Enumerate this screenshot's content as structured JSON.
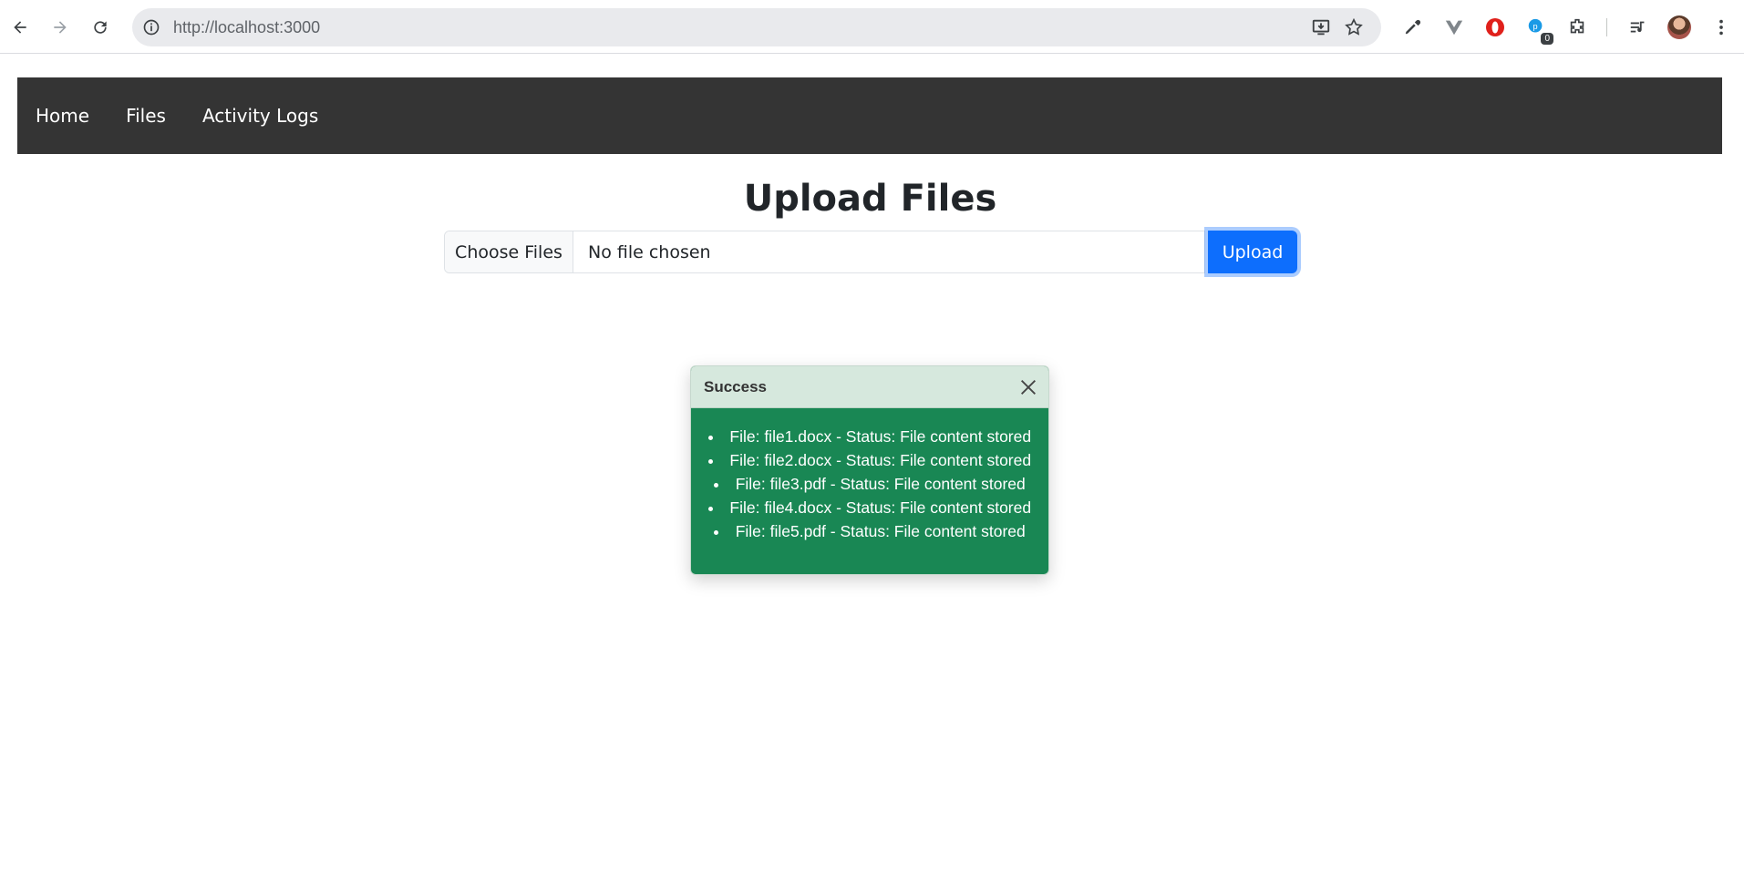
{
  "browser": {
    "url": "http://localhost:3000",
    "extension_badge": "0"
  },
  "navbar": {
    "items": [
      {
        "label": "Home"
      },
      {
        "label": "Files"
      },
      {
        "label": "Activity Logs"
      }
    ]
  },
  "main": {
    "title": "Upload Files",
    "file_input": {
      "button_label": "Choose Files",
      "status_text": "No file chosen"
    },
    "upload_label": "Upload"
  },
  "toast": {
    "title": "Success",
    "messages": [
      "File: file1.docx - Status: File content stored",
      "File: file2.docx - Status: File content stored",
      "File: file3.pdf - Status: File content stored",
      "File: file4.docx - Status: File content stored",
      "File: file5.pdf - Status: File content stored"
    ]
  },
  "colors": {
    "navbar_bg": "#343434",
    "primary": "#0d6efd",
    "success": "#198754",
    "toast_header_bg": "#d6e8dd"
  }
}
